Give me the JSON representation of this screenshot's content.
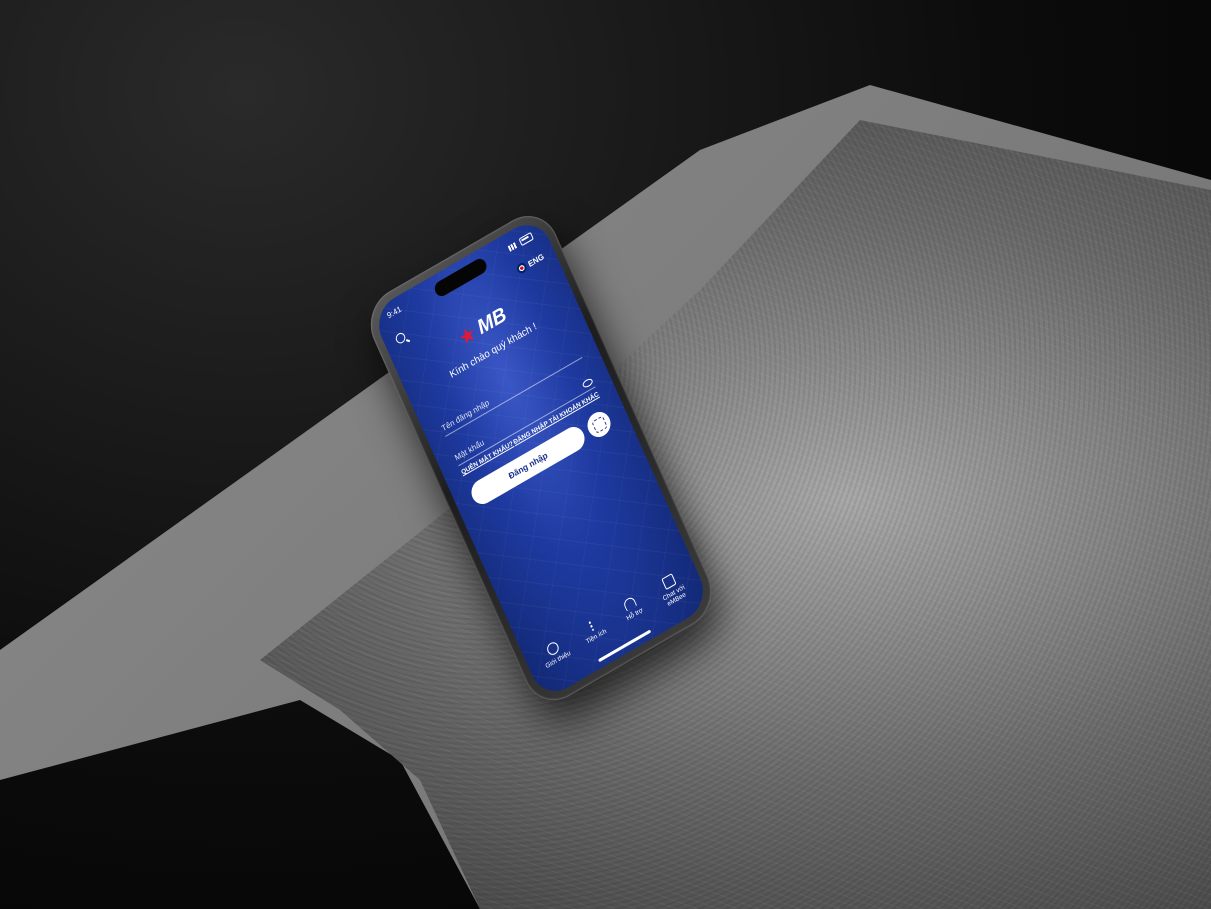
{
  "status_bar": {
    "time": "9:41"
  },
  "top_bar": {
    "language_label": "ENG"
  },
  "brand": {
    "logo_text": "MB"
  },
  "greeting": "Kính chào quý khách !",
  "login_form": {
    "username_placeholder": "Tên đăng nhập",
    "password_placeholder": "Mật khẩu",
    "forgot_password_link": "QUÊN MẬT KHẨU?",
    "other_account_link": "ĐĂNG NHẬP TÀI KHOẢN KHÁC",
    "login_button": "Đăng nhập"
  },
  "bottom_nav": {
    "items": [
      {
        "label": "Giới thiệu",
        "icon": "info-icon"
      },
      {
        "label": "Tiện ích",
        "icon": "more-dots-icon"
      },
      {
        "label": "Hỗ trợ",
        "icon": "headset-icon"
      },
      {
        "label": "Chat với eMBee",
        "icon": "chat-icon"
      }
    ]
  },
  "colors": {
    "screen_primary": "#1e3aa0",
    "brand_red": "#e31837",
    "button_text": "#1a2f8a"
  }
}
